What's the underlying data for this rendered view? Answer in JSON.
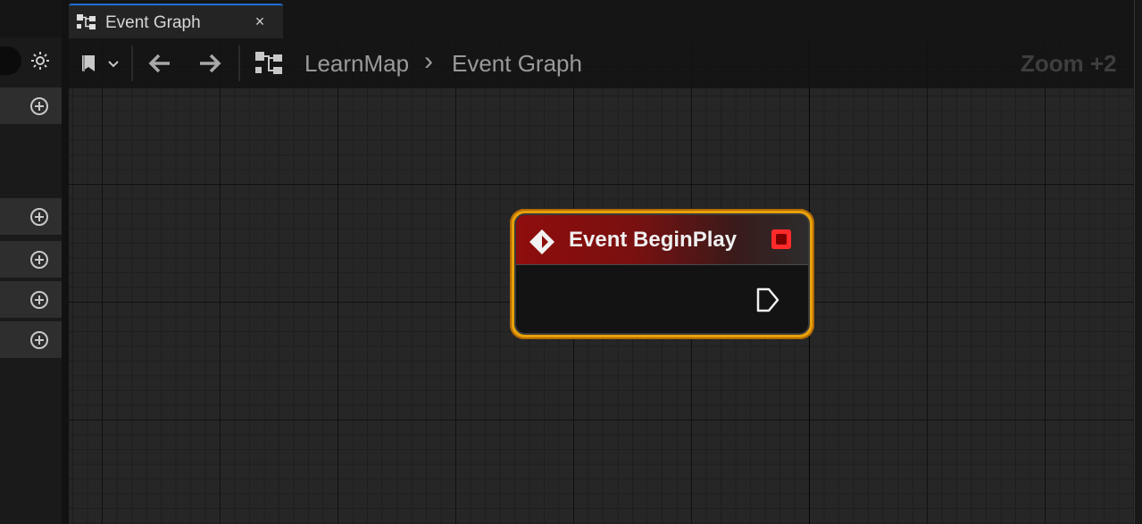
{
  "tab": {
    "label": "Event Graph",
    "close": "×"
  },
  "breadcrumb": {
    "root": "LearnMap",
    "separator": "›",
    "current": "Event Graph"
  },
  "toolbar": {
    "zoom_label": "Zoom +2"
  },
  "node": {
    "title": "Event BeginPlay"
  },
  "colors": {
    "tab_accent": "#1f6fd6",
    "node_selection_outline": "#e8a10a",
    "node_header": "#8f0d0d",
    "delegate_pin": "#ff2a2a"
  },
  "icons": {
    "gear": "gear-icon",
    "add": "plus-circle-icon",
    "bookmark": "bookmark-icon",
    "back": "arrow-left-icon",
    "forward": "arrow-right-icon",
    "graph": "graph-icon",
    "event": "event-diamond-icon",
    "exec": "exec-pin-icon"
  }
}
